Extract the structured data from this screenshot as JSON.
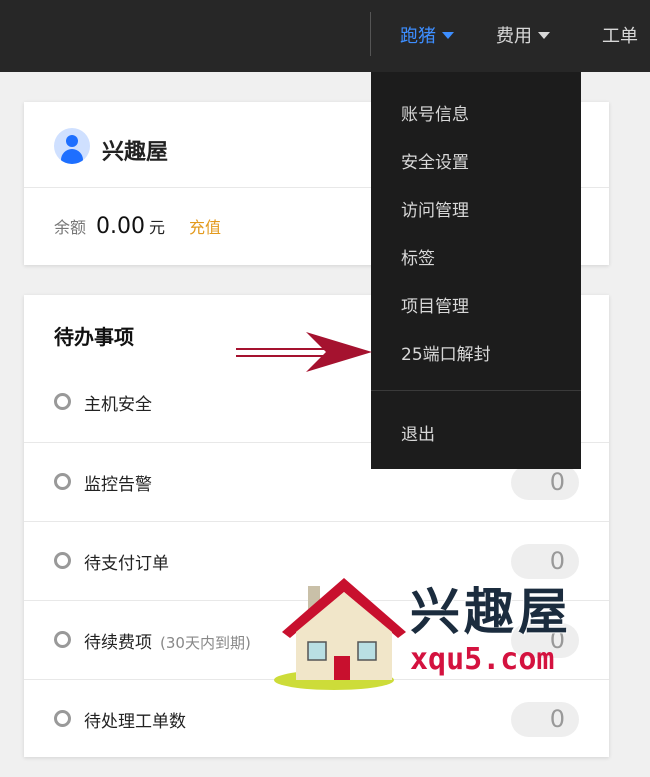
{
  "header": {
    "nav_user": "跑猪",
    "nav_fee": "费用",
    "nav_ticket": "工单"
  },
  "account": {
    "name": "兴趣屋",
    "balance_label": "余额",
    "balance_value": "0.00",
    "balance_unit": "元",
    "recharge_label": "充值"
  },
  "todo": {
    "title": "待办事项",
    "items": [
      {
        "label": "主机安全",
        "note": "",
        "count": ""
      },
      {
        "label": "监控告警",
        "note": "",
        "count": "0"
      },
      {
        "label": "待支付订单",
        "note": "",
        "count": "0"
      },
      {
        "label": "待续费项",
        "note": "(30天内到期)",
        "count": "0"
      },
      {
        "label": "待处理工单数",
        "note": "",
        "count": "0"
      }
    ]
  },
  "dropdown": {
    "items": [
      {
        "label": "账号信息"
      },
      {
        "label": "安全设置"
      },
      {
        "label": "访问管理"
      },
      {
        "label": "标签"
      },
      {
        "label": "项目管理"
      },
      {
        "label": "25端口解封"
      }
    ],
    "logout_label": "退出"
  },
  "watermark": {
    "title": "兴趣屋",
    "url": "xqu5.com"
  },
  "colors": {
    "topbar_bg": "#272727",
    "active_nav": "#3d8eff",
    "dropdown_bg": "#1c1c1c",
    "recharge": "#e39a1d",
    "arrow": "#a5122f",
    "watermark_url": "#d4123f"
  },
  "icons": {
    "avatar": "user-avatar-icon",
    "nav_caret": "caret-down-icon",
    "todo_bullet": "circle-outline-icon",
    "pointer": "right-arrow-icon",
    "house": "house-icon"
  }
}
